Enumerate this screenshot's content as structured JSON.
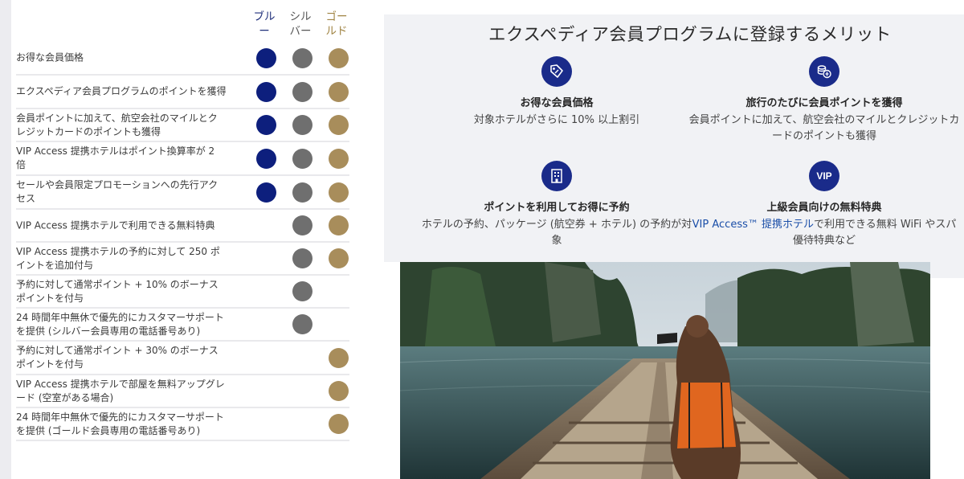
{
  "table": {
    "tiers": [
      "ブルー",
      "シルバー",
      "ゴールド"
    ],
    "tier_colors": {
      "blue": "#0d1f7d",
      "silver": "#6f6f6f",
      "gold": "#a88d5b"
    },
    "rows": [
      {
        "label": "お得な会員価格",
        "tiers": [
          "blue",
          "silver",
          "gold"
        ]
      },
      {
        "label": "エクスペディア会員プログラムのポイントを獲得",
        "tiers": [
          "blue",
          "silver",
          "gold"
        ]
      },
      {
        "label": "会員ポイントに加えて、航空会社のマイルとクレジットカードのポイントも獲得",
        "tiers": [
          "blue",
          "silver",
          "gold"
        ]
      },
      {
        "label": "VIP Access 提携ホテルはポイント換算率が 2 倍",
        "tiers": [
          "blue",
          "silver",
          "gold"
        ]
      },
      {
        "label": "セールや会員限定プロモーションへの先行アクセス",
        "tiers": [
          "blue",
          "silver",
          "gold"
        ]
      },
      {
        "label": "VIP Access 提携ホテルで利用できる無料特典",
        "tiers": [
          "silver",
          "gold"
        ]
      },
      {
        "label": "VIP Access 提携ホテルの予約に対して 250 ポイントを追加付与",
        "tiers": [
          "silver",
          "gold"
        ]
      },
      {
        "label": "予約に対して通常ポイント + 10% のボーナスポイントを付与",
        "tiers": [
          "silver"
        ]
      },
      {
        "label": "24 時間年中無休で優先的にカスタマーサポートを提供 (シルバー会員専用の電話番号あり)",
        "tiers": [
          "silver"
        ]
      },
      {
        "label": "予約に対して通常ポイント + 30% のボーナスポイントを付与",
        "tiers": [
          "gold"
        ]
      },
      {
        "label": "VIP Access 提携ホテルで部屋を無料アップグレード (空室がある場合)",
        "tiers": [
          "gold"
        ]
      },
      {
        "label": "24 時間年中無休で優先的にカスタマーサポートを提供 (ゴールド会員専用の電話番号あり)",
        "tiers": [
          "gold"
        ]
      }
    ]
  },
  "benefits": {
    "title": "エクスペディア会員プログラムに登録するメリット",
    "accent": "#1a2b8a",
    "items": [
      {
        "icon": "price-tag-icon",
        "title": "お得な会員価格",
        "desc": "対象ホテルがさらに 10% 以上割引"
      },
      {
        "icon": "coins-icon",
        "title": "旅行のたびに会員ポイントを獲得",
        "desc": "会員ポイントに加えて、航空会社のマイルとクレジットカードのポイントも獲得"
      },
      {
        "icon": "hotel-building-icon",
        "title": "ポイントを利用してお得に予約",
        "desc": "ホテルの予約、パッケージ (航空券 + ホテル) の予約が対象"
      },
      {
        "icon": "vip-icon",
        "icon_text": "VIP",
        "title": "上級会員向けの無料特典",
        "desc_link": "VIP Access™ 提携ホテル",
        "desc": "で利用できる無料 WiFi やスパ優待特典など"
      }
    ]
  }
}
